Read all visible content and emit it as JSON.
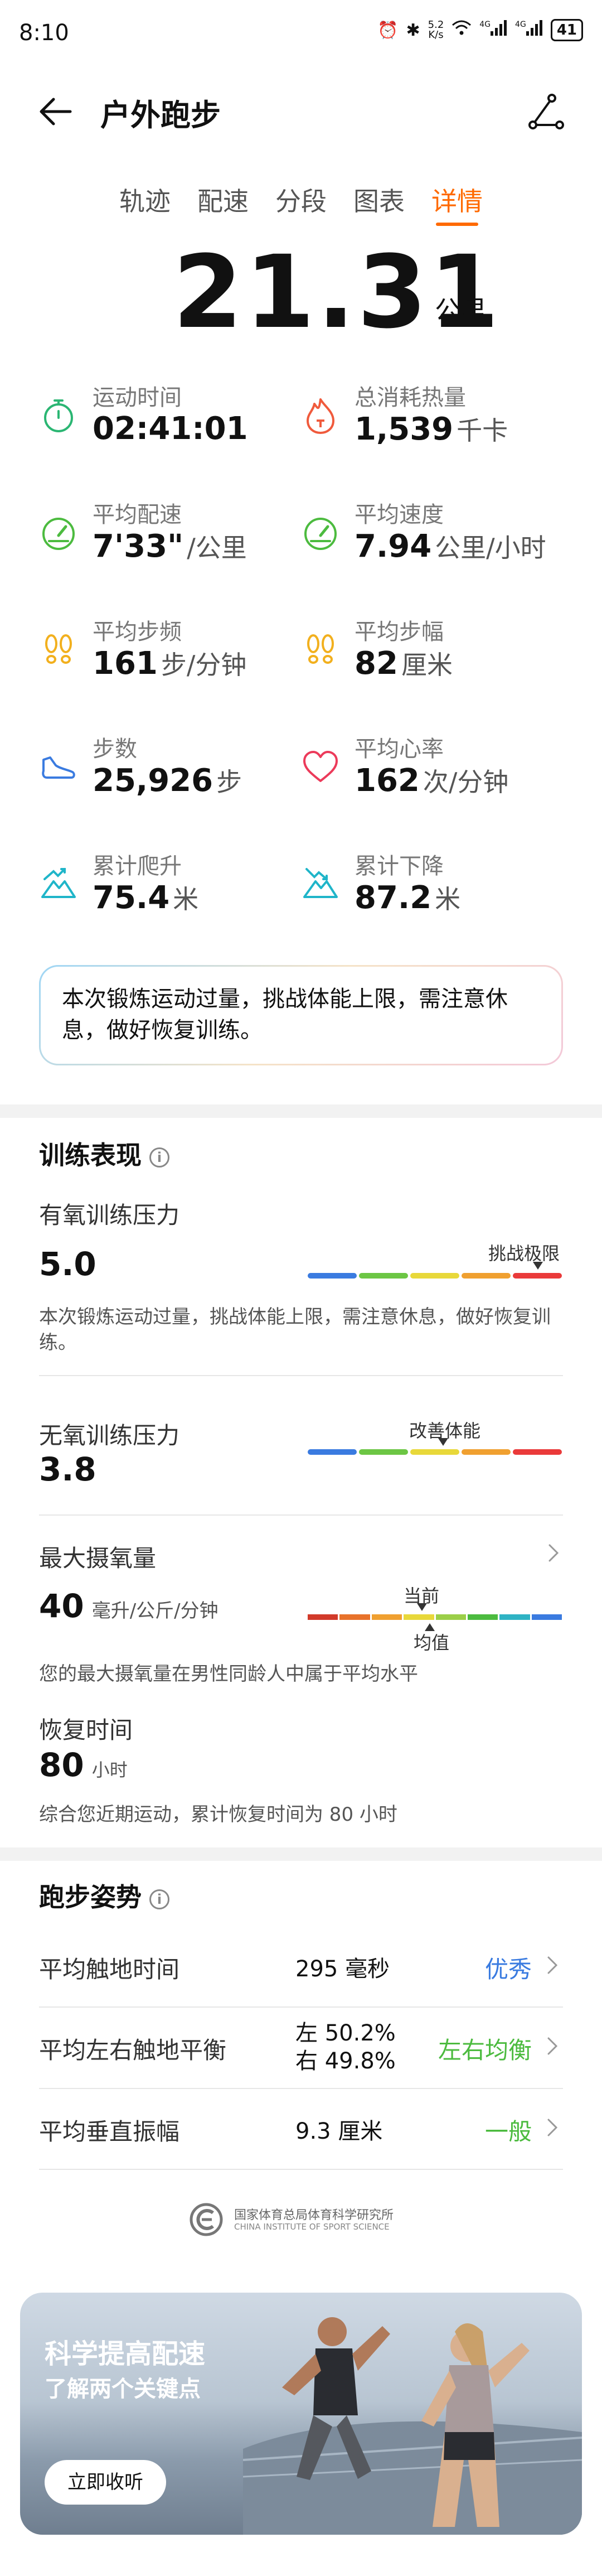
{
  "status_bar": {
    "time": "8:10",
    "net_speed_value": "5.2",
    "net_speed_unit": "K/s",
    "signal1": "4G",
    "signal2": "4G",
    "battery": "41"
  },
  "header": {
    "title": "户外跑步"
  },
  "tabs": [
    {
      "label": "轨迹",
      "active": false
    },
    {
      "label": "配速",
      "active": false
    },
    {
      "label": "分段",
      "active": false
    },
    {
      "label": "图表",
      "active": false
    },
    {
      "label": "详情",
      "active": true
    }
  ],
  "summary": {
    "distance": "21.31",
    "distance_unit": "公里"
  },
  "stats": [
    {
      "label": "运动时间",
      "value": "02:41:01",
      "unit": "",
      "icon": "stopwatch-icon",
      "color": "#2bb673"
    },
    {
      "label": "总消耗热量",
      "value": "1,539",
      "unit": "千卡",
      "icon": "flame-icon",
      "color": "#f05a3c"
    },
    {
      "label": "平均配速",
      "value": "7'33\"",
      "unit": "/公里",
      "icon": "speedometer-icon",
      "color": "#4cbb3f"
    },
    {
      "label": "平均速度",
      "value": "7.94",
      "unit": "公里/小时",
      "icon": "speedometer-icon",
      "color": "#4cbb3f"
    },
    {
      "label": "平均步频",
      "value": "161",
      "unit": "步/分钟",
      "icon": "footprints-icon",
      "color": "#f2b01e"
    },
    {
      "label": "平均步幅",
      "value": "82",
      "unit": "厘米",
      "icon": "footprints-icon",
      "color": "#f2b01e"
    },
    {
      "label": "步数",
      "value": "25,926",
      "unit": "步",
      "icon": "shoe-icon",
      "color": "#3a7be0"
    },
    {
      "label": "平均心率",
      "value": "162",
      "unit": "次/分钟",
      "icon": "heart-icon",
      "color": "#ec3a5a"
    },
    {
      "label": "累计爬升",
      "value": "75.4",
      "unit": "米",
      "icon": "mountain-up-icon",
      "color": "#1fb5c9"
    },
    {
      "label": "累计下降",
      "value": "87.2",
      "unit": "米",
      "icon": "mountain-down-icon",
      "color": "#1fb5c9"
    }
  ],
  "alert": {
    "text": "本次锻炼运动过量，挑战体能上限，需注意休息，做好恢复训练。"
  },
  "training": {
    "title": "训练表现",
    "aerobic": {
      "label": "有氧训练压力",
      "value": "5.0",
      "caption": "挑战极限",
      "desc": "本次锻炼运动过量，挑战体能上限，需注意休息，做好恢复训练。"
    },
    "anaerobic": {
      "label": "无氧训练压力",
      "value": "3.8",
      "caption": "改善体能"
    },
    "vo2max": {
      "label": "最大摄氧量",
      "value": "40",
      "unit": "毫升/公斤/分钟",
      "current_label": "当前",
      "avg_label": "均值",
      "desc": "您的最大摄氧量在男性同龄人中属于平均水平"
    },
    "recovery": {
      "label": "恢复时间",
      "value": "80",
      "unit": "小时",
      "desc": "综合您近期运动，累计恢复时间为 80 小时"
    },
    "bar_colors": [
      "#3a7be0",
      "#6cc644",
      "#e8d83a",
      "#f0a030",
      "#ea3a3a"
    ]
  },
  "posture": {
    "title": "跑步姿势",
    "rows": [
      {
        "label": "平均触地时间",
        "value": "295 毫秒",
        "rating": "优秀",
        "rating_color": "#3a7be0"
      },
      {
        "label": "平均左右触地平衡",
        "value_line1": "左 50.2%",
        "value_line2": "右 49.8%",
        "rating": "左右均衡",
        "rating_color": "#4cbb3f"
      },
      {
        "label": "平均垂直振幅",
        "value": "9.3 厘米",
        "rating": "一般",
        "rating_color": "#4cbb3f"
      }
    ]
  },
  "logo": {
    "name_cn": "国家体育总局体育科学研究所",
    "name_en": "CHINA INSTITUTE OF SPORT SCIENCE"
  },
  "banner": {
    "title": "科学提高配速",
    "subtitle": "了解两个关键点",
    "button": "立即收听"
  }
}
